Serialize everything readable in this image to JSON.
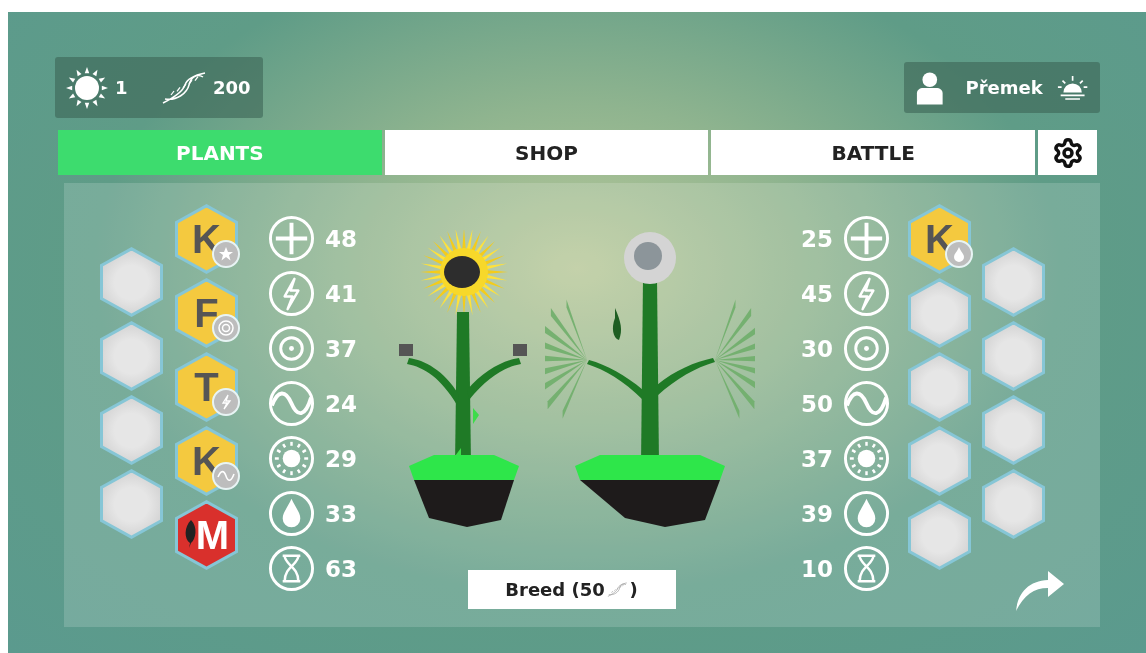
{
  "resources": {
    "sun": "1",
    "dna": "200"
  },
  "user": {
    "name": "Přemek"
  },
  "tabs": [
    {
      "label": "PLANTS",
      "selected": true
    },
    {
      "label": "SHOP",
      "selected": false
    },
    {
      "label": "BATTLE",
      "selected": false
    }
  ],
  "plants": [
    {
      "kind": "sunflower",
      "empty_slots": [
        {
          "kind": "empty"
        },
        {
          "kind": "empty"
        },
        {
          "kind": "empty"
        },
        {
          "kind": "empty"
        }
      ],
      "genes": [
        {
          "kind": "gene",
          "letter": "K",
          "badge": {
            "kind": "star"
          },
          "color": "#f4c93f"
        },
        {
          "kind": "gene",
          "letter": "F",
          "badge": {
            "kind": "target"
          },
          "color": "#f4c93f"
        },
        {
          "kind": "gene",
          "letter": "T",
          "badge": {
            "kind": "bolt"
          },
          "color": "#f4c93f"
        },
        {
          "kind": "gene",
          "letter": "K",
          "badge": {
            "kind": "wave"
          },
          "color": "#f4c93f"
        },
        {
          "kind": "mutation",
          "letter": "M",
          "color": "#d9302c"
        }
      ],
      "stats": [
        {
          "kind": "plus",
          "value": "48"
        },
        {
          "kind": "bolt",
          "value": "41"
        },
        {
          "kind": "target",
          "value": "37"
        },
        {
          "kind": "wave",
          "value": "24"
        },
        {
          "kind": "sun",
          "value": "29"
        },
        {
          "kind": "drop",
          "value": "33"
        },
        {
          "kind": "hourglass",
          "value": "63"
        }
      ]
    },
    {
      "kind": "fan",
      "empty_slots": [
        {
          "kind": "empty"
        },
        {
          "kind": "empty"
        },
        {
          "kind": "empty"
        },
        {
          "kind": "empty"
        }
      ],
      "genes": [
        {
          "kind": "gene",
          "letter": "K",
          "badge": {
            "kind": "drop"
          },
          "color": "#f4c93f"
        },
        {
          "kind": "empty"
        },
        {
          "kind": "empty"
        },
        {
          "kind": "empty"
        },
        {
          "kind": "empty"
        }
      ],
      "stats": [
        {
          "kind": "plus",
          "value": "25"
        },
        {
          "kind": "bolt",
          "value": "45"
        },
        {
          "kind": "target",
          "value": "30"
        },
        {
          "kind": "wave",
          "value": "50"
        },
        {
          "kind": "sun",
          "value": "37"
        },
        {
          "kind": "drop",
          "value": "39"
        },
        {
          "kind": "hourglass",
          "value": "10"
        }
      ]
    }
  ],
  "breed": {
    "label": "Breed (50",
    "suffix": ")"
  }
}
